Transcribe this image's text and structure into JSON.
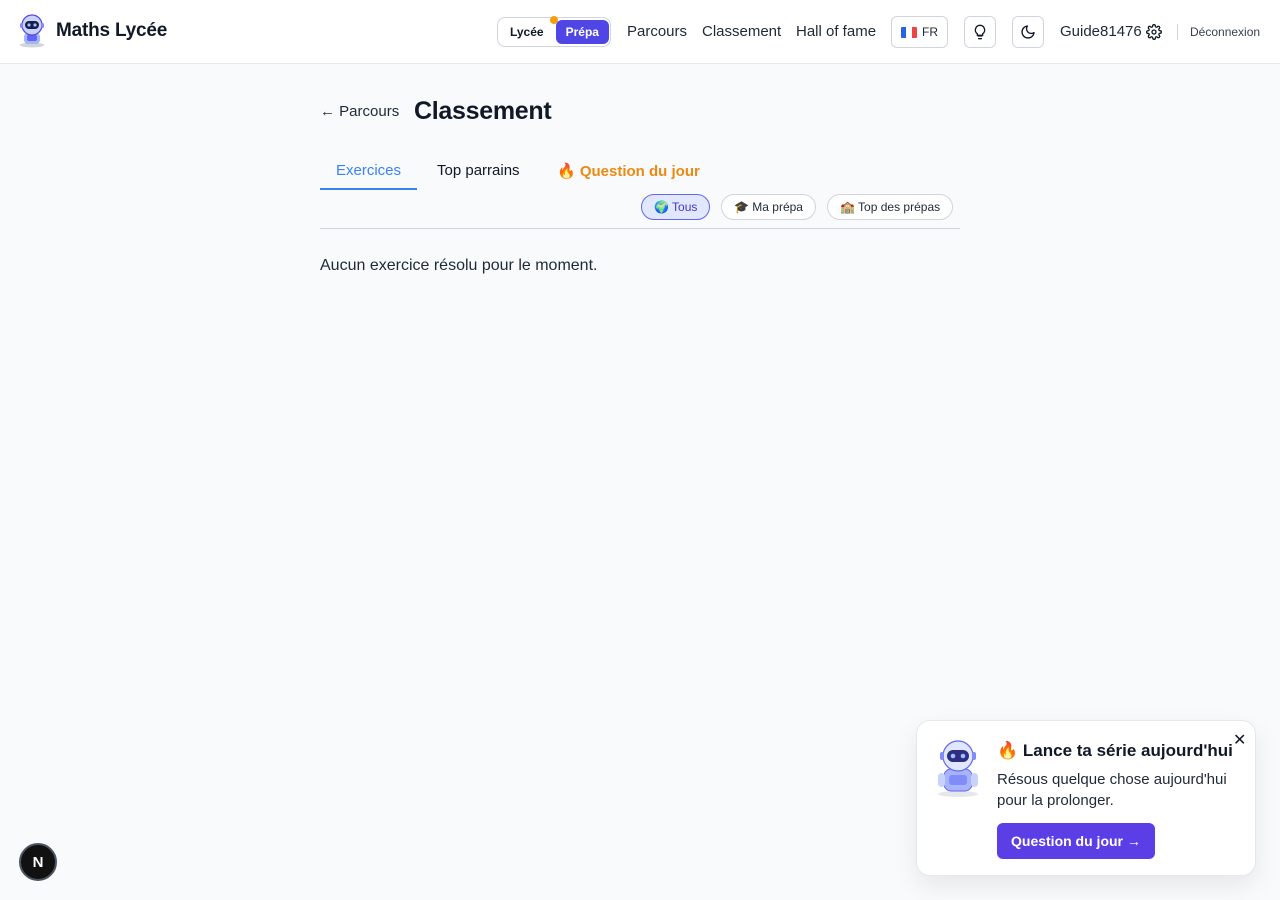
{
  "brand": {
    "name": "Maths Lycée"
  },
  "level_switch": {
    "options": [
      "Lycée",
      "Prépa"
    ],
    "selected": "Prépa"
  },
  "nav": {
    "items": [
      "Parcours",
      "Classement",
      "Hall of fame"
    ]
  },
  "language": {
    "label": "FR"
  },
  "user": {
    "name": "Guide81476",
    "logout_label": "Déconnexion"
  },
  "page": {
    "back_label": "← Parcours",
    "title": "Classement"
  },
  "tabs": [
    {
      "label": "Exercices",
      "active": true
    },
    {
      "label": "Top parrains",
      "active": false
    },
    {
      "label": "🔥 Question du jour",
      "active": false
    }
  ],
  "filters": [
    {
      "label": "🌍 Tous",
      "active": true
    },
    {
      "label": "🎓 Ma prépa",
      "active": false
    },
    {
      "label": "🏫 Top des prépas",
      "active": false
    }
  ],
  "empty_message": "Aucun exercice résolu pour le moment.",
  "toast": {
    "title": "🔥 Lance ta série aujourd'hui",
    "text": "Résous quelque chose aujourd'hui pour la prolonger.",
    "cta": "Question du jour →",
    "close": "✕"
  },
  "dev_badge": "N",
  "colors": {
    "accent": "#4f46e5",
    "tab_active": "#3b82f6",
    "fire": "#ea8a12",
    "cta": "#5b3ee6"
  },
  "icons": [
    "robot-logo",
    "lightbulb-icon",
    "moon-icon",
    "gear-icon",
    "close-icon",
    "french-flag-icon"
  ]
}
